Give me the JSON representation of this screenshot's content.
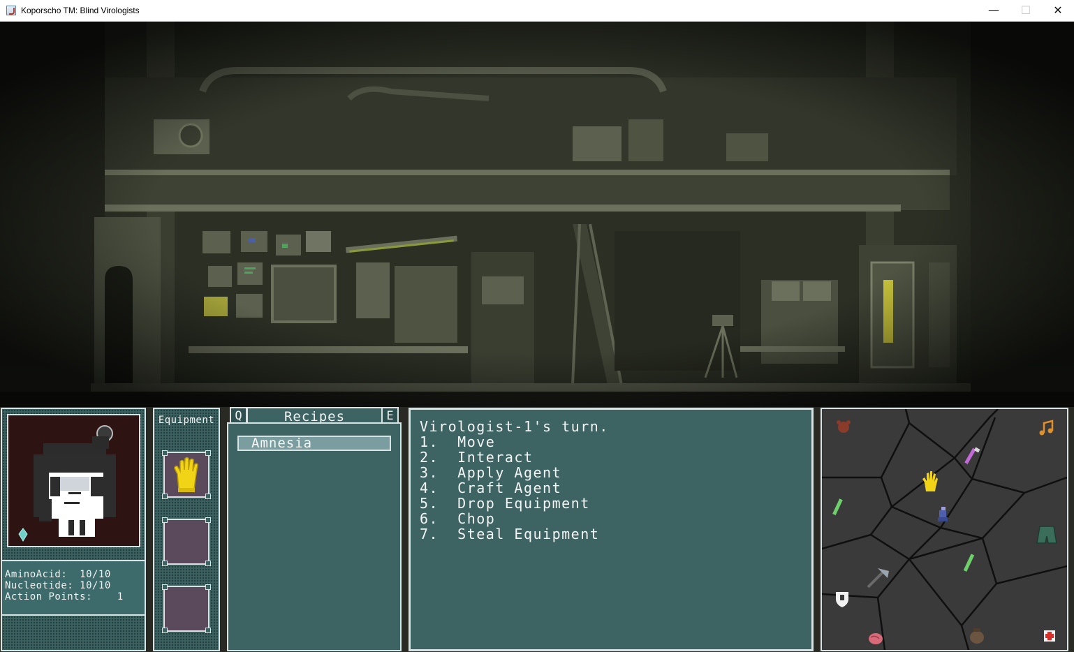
{
  "window": {
    "title": "Koporscho TM: Blind Virologists"
  },
  "stats": {
    "amino": "AminoAcid:  10/10",
    "nucleotide": "Nucleotide: 10/10",
    "action_points": "Action Points:    1"
  },
  "equipment": {
    "title": "Equipment",
    "slots": [
      "glove",
      "empty",
      "empty"
    ]
  },
  "recipes": {
    "title": "Recipes",
    "key_prev": "Q",
    "key_next": "E",
    "items": [
      "Amnesia"
    ]
  },
  "log": {
    "lines": [
      "Virologist-1's turn.",
      "1.  Move",
      "2.  Interact",
      "3.  Apply Agent",
      "4.  Craft Agent",
      "5.  Drop Equipment",
      "6.  Chop",
      "7.  Steal Equipment"
    ]
  },
  "map": {
    "items": [
      "bear-head-icon",
      "music-note-icon",
      "purple-vial-icon",
      "glove-icon",
      "green-vial-icon",
      "virologist-icon",
      "cloak-icon",
      "green-vial-icon",
      "axe-icon",
      "shield-icon",
      "brain-icon",
      "sack-icon",
      "first-aid-icon"
    ]
  },
  "colors": {
    "panel_teal": "#3d6363",
    "border": "#d8e4e4",
    "slot": "#5a4a5b",
    "map_bg": "#3a3a3a"
  }
}
